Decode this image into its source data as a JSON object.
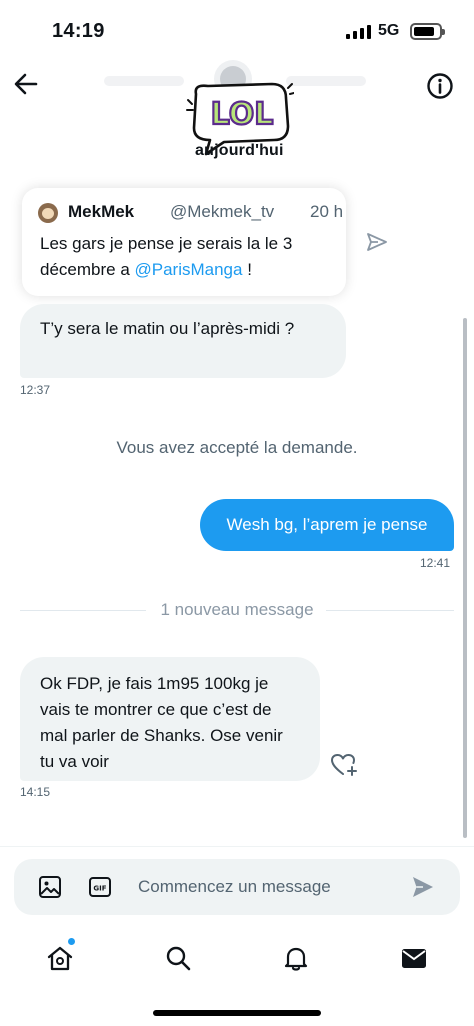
{
  "status_bar": {
    "time": "14:19",
    "network": "5G"
  },
  "header": {
    "sticker_text": "LOL",
    "date_label": "aujourd'hui"
  },
  "conversation": {
    "quoted_tweet": {
      "name": "MekMek",
      "handle": "@Mekmek_tv",
      "time": "20 h",
      "text_before": "Les gars je pense je serais la le 3 décembre a ",
      "mention": "@ParisManga",
      "text_after": " !"
    },
    "messages": [
      {
        "text": "T’y sera le matin ou l’après-midi ?",
        "time": "12:37"
      },
      {
        "text": "Wesh bg, l’aprem je pense",
        "time": "12:41"
      },
      {
        "text": "Ok FDP, je fais 1m95 100kg je vais te montrer ce que c’est de mal parler de Shanks. Ose venir tu va voir",
        "time": "14:15"
      }
    ],
    "system_message": "Vous avez accepté la demande.",
    "new_message_divider": "1 nouveau message"
  },
  "composer": {
    "placeholder": "Commencez un message"
  },
  "icons": {
    "back": "arrow-left-icon",
    "info": "info-icon",
    "share": "send-icon",
    "react": "heart-plus-icon",
    "media": "image-icon",
    "gif": "gif-icon",
    "send": "send-icon",
    "tabs": [
      "home-icon",
      "search-icon",
      "bell-icon",
      "mail-icon"
    ]
  },
  "colors": {
    "accent": "#1d9bf0",
    "bubble_incoming": "#eff3f4",
    "text_secondary": "#536471"
  }
}
